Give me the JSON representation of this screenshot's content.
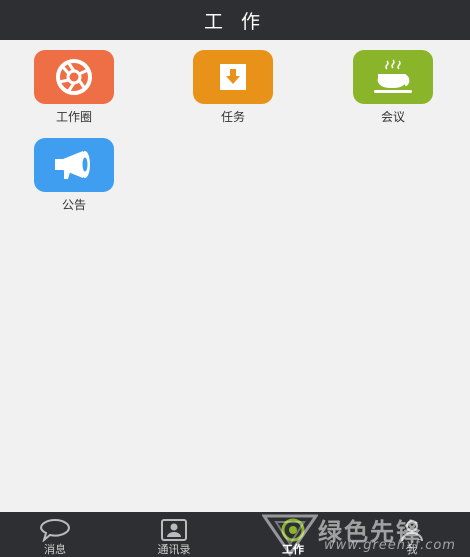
{
  "header": {
    "title": "工 作"
  },
  "apps": [
    {
      "label": "工作圈",
      "icon": "aperture-icon",
      "color": "#ee6f46"
    },
    {
      "label": "任务",
      "icon": "download-icon",
      "color": "#e89219"
    },
    {
      "label": "会议",
      "icon": "coffee-cup-icon",
      "color": "#8ab52b"
    },
    {
      "label": "公告",
      "icon": "megaphone-icon",
      "color": "#3f9ef0"
    }
  ],
  "tabbar": {
    "tabs": [
      {
        "label": "消息",
        "icon": "chat-bubble-icon"
      },
      {
        "label": "通讯录",
        "icon": "contacts-icon"
      },
      {
        "label": "工作",
        "icon": "work-icon",
        "active": true
      },
      {
        "label": "我",
        "icon": "person-icon"
      }
    ]
  },
  "watermark": {
    "text": "绿色先锋",
    "url": "www.greenxf.com"
  },
  "colors": {
    "bar": "#2e2f33",
    "background": "#f1f1f1"
  }
}
